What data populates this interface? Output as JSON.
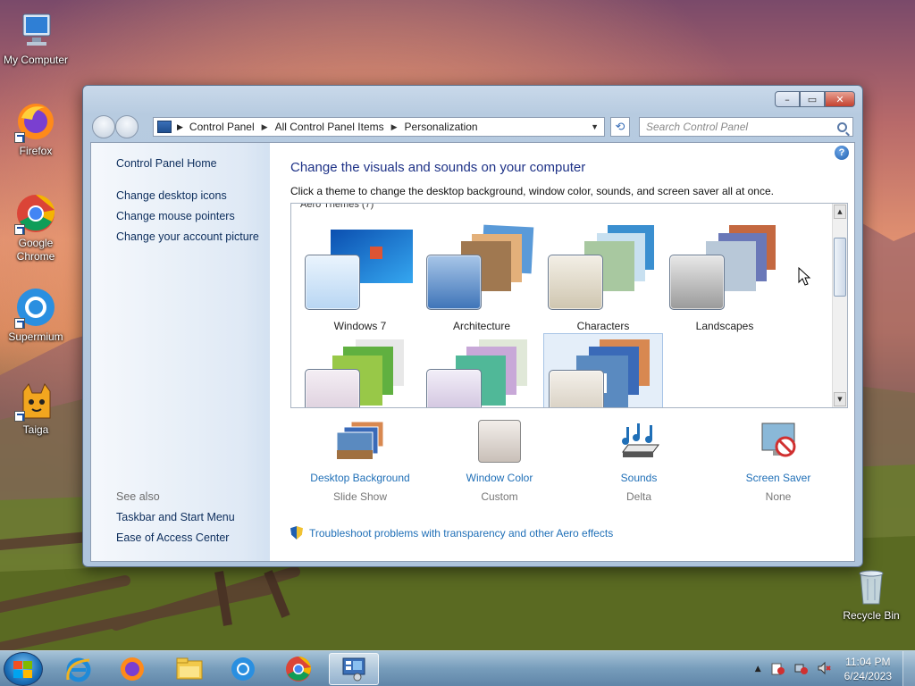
{
  "desktop": {
    "icons": [
      {
        "label": "My Computer",
        "icon": "computer-icon"
      },
      {
        "label": "Firefox",
        "icon": "firefox-icon"
      },
      {
        "label": "Google Chrome",
        "icon": "chrome-icon"
      },
      {
        "label": "Supermium",
        "icon": "supermium-icon"
      },
      {
        "label": "Taiga",
        "icon": "taiga-icon"
      },
      {
        "label": "Recycle Bin",
        "icon": "recycle-bin-icon"
      }
    ]
  },
  "window": {
    "title_buttons": {
      "minimize": "–",
      "maximize": "▭",
      "close": "✕"
    },
    "breadcrumb": [
      "Control Panel",
      "All Control Panel Items",
      "Personalization"
    ],
    "search_placeholder": "Search Control Panel",
    "help": "?"
  },
  "sidebar": {
    "home": "Control Panel Home",
    "links": [
      "Change desktop icons",
      "Change mouse pointers",
      "Change your account picture"
    ],
    "see_also_header": "See also",
    "see_also": [
      "Taskbar and Start Menu",
      "Ease of Access Center"
    ]
  },
  "main": {
    "heading": "Change the visuals and sounds on your computer",
    "subtitle": "Click a theme to change the desktop background, window color, sounds, and screen saver all at once.",
    "group_header": "Aero Themes (7)",
    "themes": [
      {
        "label": "Windows 7"
      },
      {
        "label": "Architecture"
      },
      {
        "label": "Characters"
      },
      {
        "label": "Landscapes"
      },
      {
        "label": ""
      },
      {
        "label": ""
      },
      {
        "label": "",
        "selected": true
      }
    ],
    "bottom": [
      {
        "label": "Desktop Background",
        "value": "Slide Show",
        "icon": "desktop-background-icon"
      },
      {
        "label": "Window Color",
        "value": "Custom",
        "icon": "window-color-icon"
      },
      {
        "label": "Sounds",
        "value": "Delta",
        "icon": "sounds-icon"
      },
      {
        "label": "Screen Saver",
        "value": "None",
        "icon": "screen-saver-icon"
      }
    ],
    "troubleshoot": "Troubleshoot problems with transparency and other Aero effects"
  },
  "taskbar": {
    "time": "11:04 PM",
    "date": "6/24/2023",
    "tray_arrow": "▲"
  }
}
